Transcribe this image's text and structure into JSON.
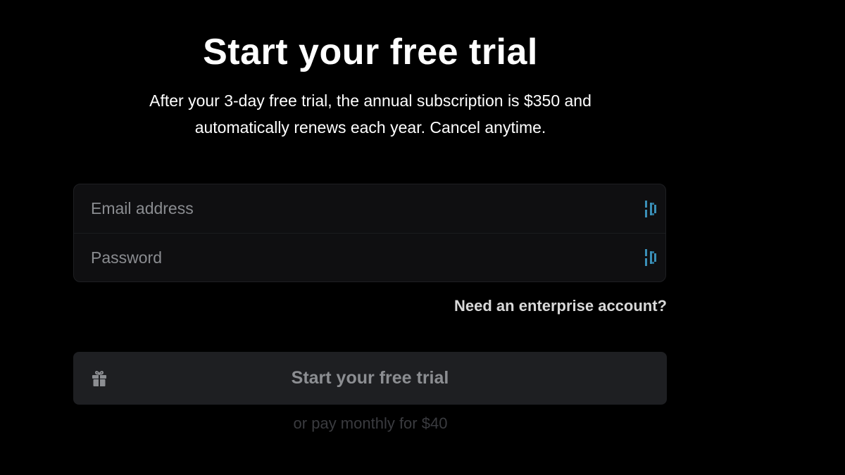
{
  "heading": {
    "title": "Start your free trial",
    "subtitle_line1": "After your 3-day free trial, the annual subscription is $350 and",
    "subtitle_line2": "automatically renews each year. Cancel anytime."
  },
  "form": {
    "email": {
      "placeholder": "Email address",
      "value": ""
    },
    "password": {
      "placeholder": "Password",
      "value": ""
    },
    "password_manager_icon": "password-manager-icon"
  },
  "enterprise_link": "Need an enterprise account?",
  "cta": {
    "label": "Start your free trial",
    "icon": "gift-icon"
  },
  "monthly_option": "or pay monthly for $40",
  "colors": {
    "background": "#000000",
    "field_background": "#0f0f11",
    "button_background": "#1e1f22",
    "button_text": "#8c8e92",
    "password_manager_accent": "#3a8fb7",
    "monthly_text": "#3a3b3f"
  }
}
